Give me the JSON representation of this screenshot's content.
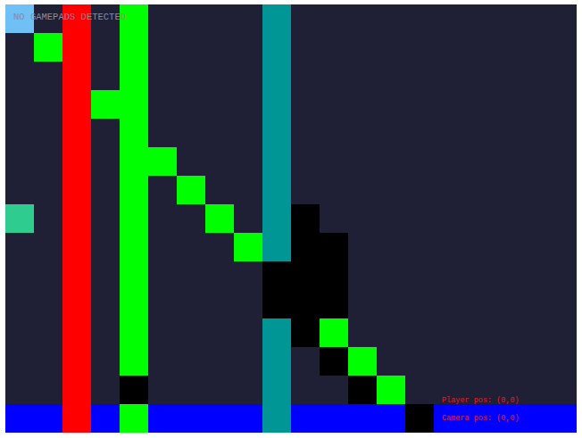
{
  "hud": {
    "gamepad_status": "NO GAMEPADS DETECTED",
    "player_pos": "Player pos: (0,0)",
    "camera_pos": "Camera pos: (0,0)"
  },
  "legend": [
    {
      "char": ".",
      "color": "#1f1f35"
    },
    {
      "char": "S",
      "color": "#6ec0f5"
    },
    {
      "char": "G",
      "color": "#00ff00"
    },
    {
      "char": "R",
      "color": "#ff0000"
    },
    {
      "char": "T",
      "color": "#009696"
    },
    {
      "char": "K",
      "color": "#000000"
    },
    {
      "char": "M",
      "color": "#2ecc8e"
    },
    {
      "char": "B",
      "color": "#0000ff"
    }
  ],
  "map": {
    "rows": [
      "S.R.G....T..........",
      ".GR.G....T..........",
      "..R.G....T..........",
      "..RGG....T..........",
      "..R.G....T..........",
      "..R.GG...T..........",
      "..R.G.G..T..........",
      "M.R.G..G.TK.........",
      "..R.G...GTKK........",
      "..R.G....KKK........",
      "..R.G....KKK........",
      "..R.G....TKG........",
      "..R.G....T.KG.......",
      "..R.K....T..KG......",
      "BBRBGBBBBTBBBBKBBBBB"
    ]
  }
}
